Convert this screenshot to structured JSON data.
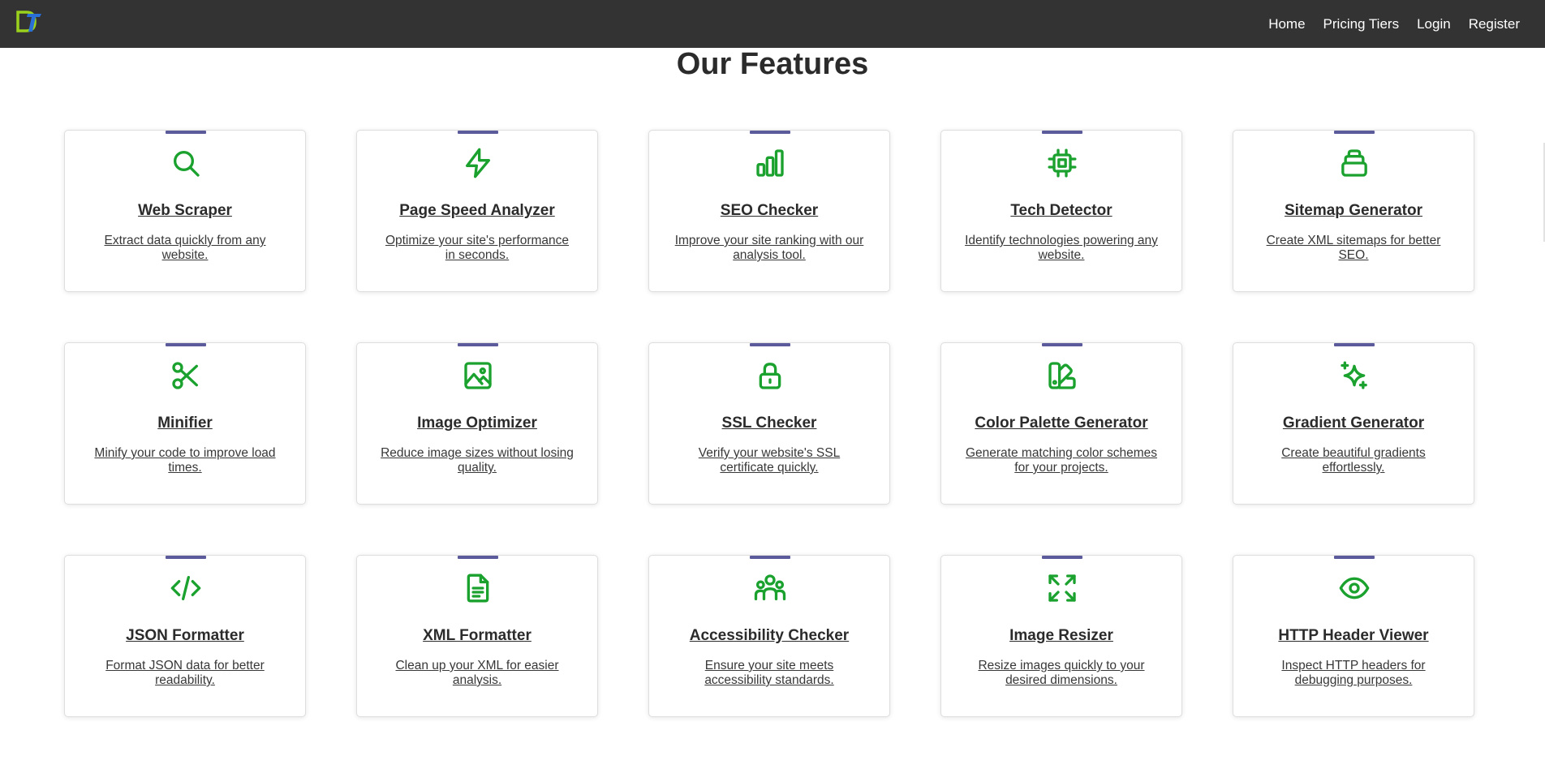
{
  "nav": {
    "logo_icon": "dt-logo-icon",
    "links": [
      "Home",
      "Pricing Tiers",
      "Login",
      "Register"
    ]
  },
  "page_title": "Our Features",
  "colors": {
    "navbar": "#333333",
    "accent_bar": "#5b5b9c",
    "icon": "#1aa12e",
    "text": "#2b2b2b"
  },
  "features": [
    {
      "title": "Web Scraper",
      "desc": "Extract data quickly from any website.",
      "icon": "search-icon"
    },
    {
      "title": "Page Speed Analyzer",
      "desc": "Optimize your site's performance in seconds.",
      "icon": "lightning-icon"
    },
    {
      "title": "SEO Checker",
      "desc": "Improve your site ranking with our analysis tool.",
      "icon": "bar-chart-icon"
    },
    {
      "title": "Tech Detector",
      "desc": "Identify technologies powering any website.",
      "icon": "cpu-chip-icon"
    },
    {
      "title": "Sitemap Generator",
      "desc": "Create XML sitemaps for better SEO.",
      "icon": "stack-icon"
    },
    {
      "title": "Minifier",
      "desc": "Minify your code to improve load times.",
      "icon": "scissors-icon"
    },
    {
      "title": "Image Optimizer",
      "desc": "Reduce image sizes without losing quality.",
      "icon": "image-icon"
    },
    {
      "title": "SSL Checker",
      "desc": "Verify your website's SSL certificate quickly.",
      "icon": "lock-icon"
    },
    {
      "title": "Color Palette Generator",
      "desc": "Generate matching color schemes for your projects.",
      "icon": "swatch-icon"
    },
    {
      "title": "Gradient Generator",
      "desc": "Create beautiful gradients effortlessly.",
      "icon": "sparkles-icon"
    },
    {
      "title": "JSON Formatter",
      "desc": "Format JSON data for better readability.",
      "icon": "code-icon"
    },
    {
      "title": "XML Formatter",
      "desc": "Clean up your XML for easier analysis.",
      "icon": "document-icon"
    },
    {
      "title": "Accessibility Checker",
      "desc": "Ensure your site meets accessibility standards.",
      "icon": "users-group-icon"
    },
    {
      "title": "Image Resizer",
      "desc": "Resize images quickly to your desired dimensions.",
      "icon": "expand-arrows-icon"
    },
    {
      "title": "HTTP Header Viewer",
      "desc": "Inspect HTTP headers for debugging purposes.",
      "icon": "eye-icon"
    }
  ]
}
